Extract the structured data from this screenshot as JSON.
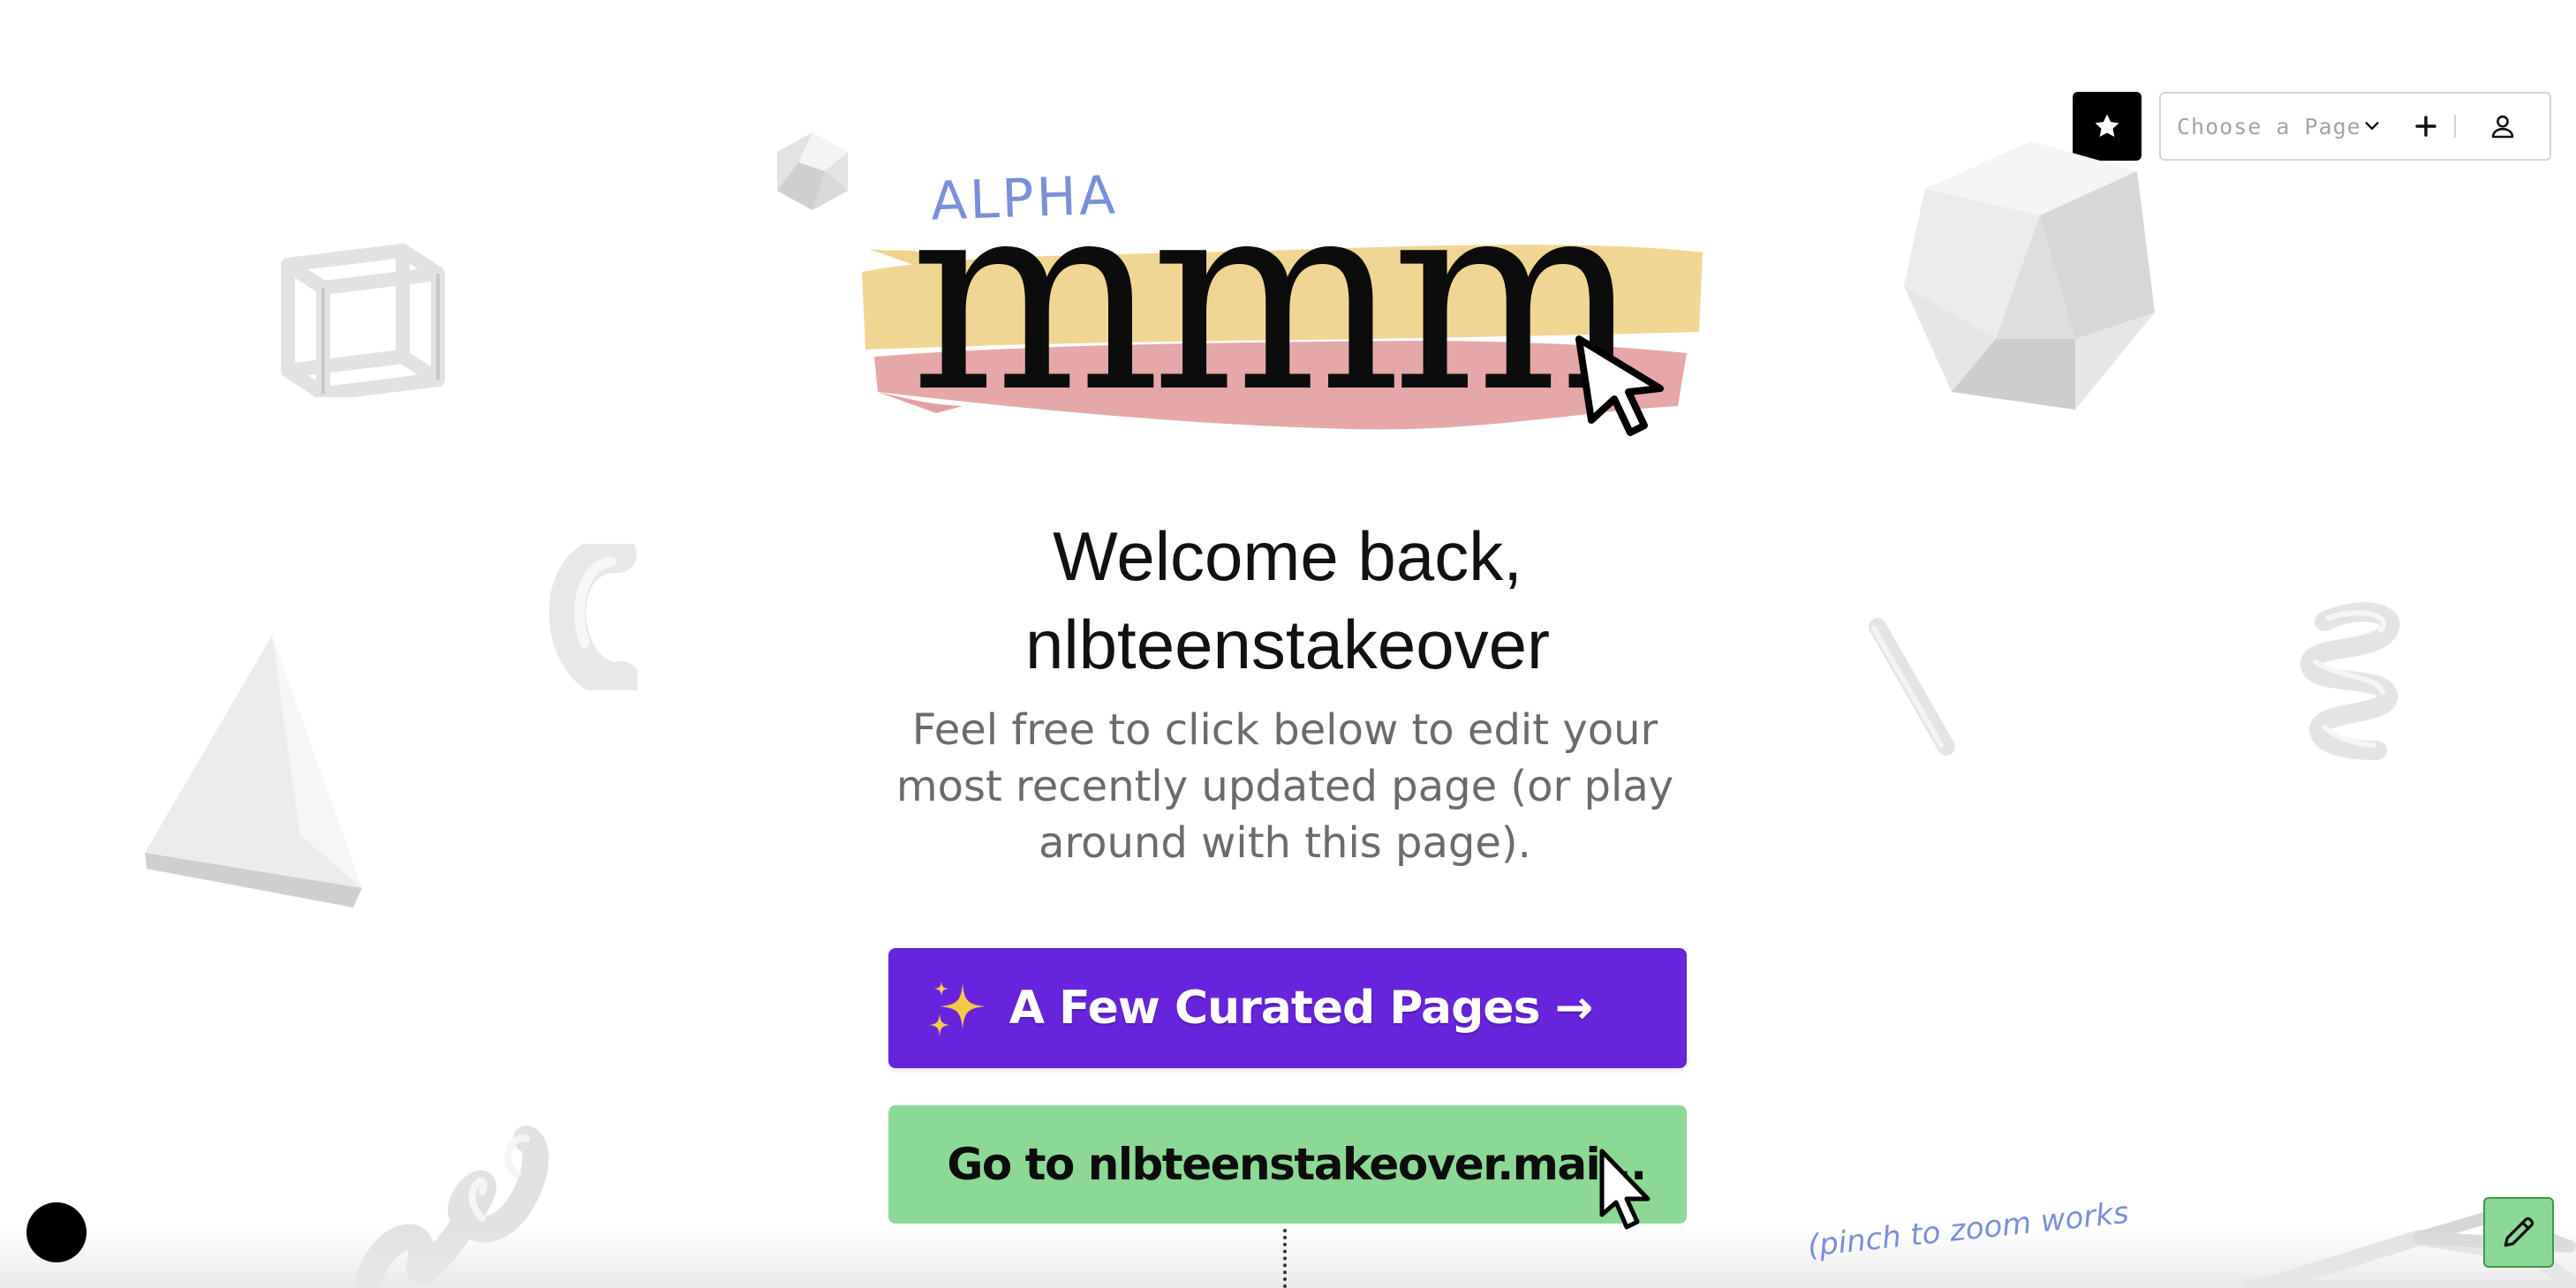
{
  "toolbar": {
    "favorites_icon": "star-icon",
    "page_select_placeholder": "Choose a Page",
    "add_icon": "plus-icon",
    "user_icon": "user-icon"
  },
  "logo": {
    "badge": "ALPHA",
    "wordmark": "mmm"
  },
  "welcome": {
    "line1": "Welcome back,",
    "line2": "nlbteenstakeover"
  },
  "subtitle": "Feel free to click below to edit your most recently updated page (or play around with this page).",
  "buttons": {
    "curated": "A Few Curated Pages →",
    "curated_icon": "sparkles-icon",
    "goto": "Go to nlbteenstakeover.mai..."
  },
  "footer": {
    "pinch_note": "(pinch to zoom works",
    "edit_icon": "pencil-icon"
  },
  "colors": {
    "curated_bg": "#6824dc",
    "goto_bg": "#8cd996",
    "alpha_text": "#7b8fd9",
    "brush_yellow": "#f0d38a",
    "brush_pink": "#e3a0a0"
  }
}
